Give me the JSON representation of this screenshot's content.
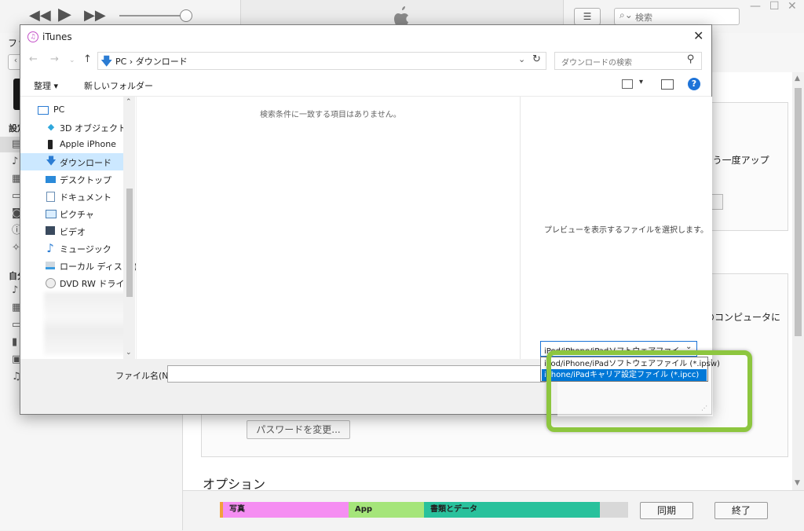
{
  "itunes": {
    "search_placeholder": "検索",
    "menu_fragment": "ファ",
    "sidebar": {
      "head1": "設定",
      "head2": "自分"
    },
    "panel1_text": "もう一度アップ",
    "panel2_text": "のコンピュータに",
    "change_password_label": "パスワードを変更...",
    "options_heading": "オプション",
    "storage": [
      {
        "label": "写真",
        "color": "#f58ef2"
      },
      {
        "label": "App",
        "color": "#a5e57a"
      },
      {
        "label": "書類とデータ",
        "color": "#29c19c"
      }
    ],
    "sync_label": "同期",
    "done_label": "終了"
  },
  "dialog": {
    "title": "iTunes",
    "breadcrumbs": "PC  ›  ダウンロード",
    "search_placeholder": "ダウンロードの検索",
    "organize_label": "整理 ▾",
    "new_folder_label": "新しいフォルダー",
    "nav_items": [
      {
        "label": "PC",
        "icon": "pc-icon"
      },
      {
        "label": "3D オブジェクト",
        "icon": "3d-objects-icon"
      },
      {
        "label": "Apple iPhone",
        "icon": "iphone-icon"
      },
      {
        "label": "ダウンロード",
        "icon": "download-icon"
      },
      {
        "label": "デスクトップ",
        "icon": "desktop-icon"
      },
      {
        "label": "ドキュメント",
        "icon": "document-icon"
      },
      {
        "label": "ピクチャ",
        "icon": "picture-icon"
      },
      {
        "label": "ビデオ",
        "icon": "video-icon"
      },
      {
        "label": "ミュージック",
        "icon": "music-icon"
      },
      {
        "label": "ローカル ディスク (C",
        "icon": "local-disk-icon"
      },
      {
        "label": "DVD RW ドライブ (",
        "icon": "dvd-drive-icon"
      }
    ],
    "empty_message": "検索条件に一致する項目はありません。",
    "preview_message": "プレビューを表示するファイルを選択します。",
    "filename_label": "ファイル名(N):",
    "filename_value": "",
    "filetype_selected": "iPod/iPhone/iPadソフトウェアファイ",
    "filetype_options": [
      "iPod/iPhone/iPadソフトウェアファイル (*.ipsw)",
      "iPhone/iPadキャリア設定ファイル (*.ipcc)"
    ],
    "highlight_color": "#8dc63f",
    "selection_color": "#0078d7"
  }
}
